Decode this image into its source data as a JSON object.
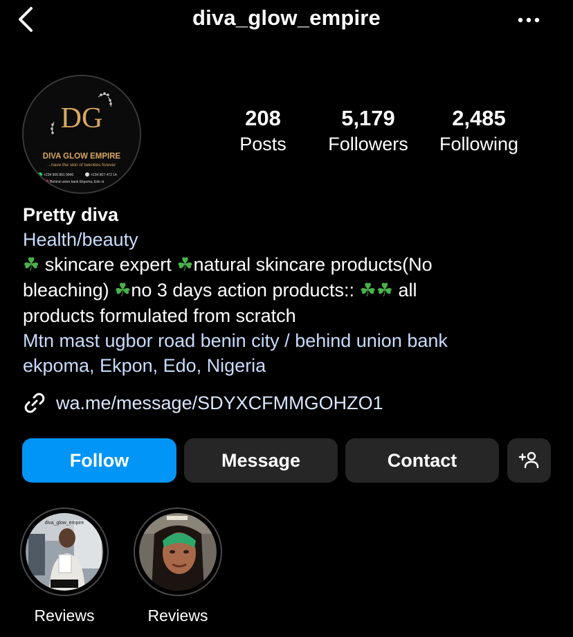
{
  "header": {
    "username": "diva_glow_empire",
    "back_icon": "chevron-left-icon",
    "more_icon": "more-horizontal-icon"
  },
  "avatar": {
    "monogram": "DG",
    "brand": "DIVA GLOW EMPIRE",
    "tagline": "...have the skin of twenties forever",
    "phone1": "+234 906 891 9940",
    "phone2": "+234 907 472 14",
    "address": "Behind union bank Ekpoma, Edo st"
  },
  "stats": [
    {
      "value": "208",
      "label": "Posts"
    },
    {
      "value": "5,179",
      "label": "Followers"
    },
    {
      "value": "2,485",
      "label": "Following"
    }
  ],
  "bio": {
    "name": "Pretty diva",
    "category": "Health/beauty",
    "line1": " skincare expert ",
    "line1b": "natural skincare products(No",
    "line2": "bleaching) ",
    "line2b": "no 3 days action products:: ",
    "line2c": " all",
    "line3": "products formulated from scratch",
    "location": "Mtn mast ugbor road benin city /  behind union bank\nekpoma, Ekpon, Edo, Nigeria",
    "emoji": "☘"
  },
  "link": {
    "text": "wa.me/message/SDYXCFMMGOHZO1",
    "icon": "link-icon"
  },
  "actions": {
    "follow": "Follow",
    "message": "Message",
    "contact": "Contact",
    "add_user_icon": "add-user-icon"
  },
  "highlights": [
    {
      "label": "Reviews",
      "overlay": "diva_glow_empire"
    },
    {
      "label": "Reviews",
      "overlay": ""
    }
  ],
  "colors": {
    "background": "#000000",
    "follow_button": "#0095f6",
    "secondary_button": "#262626",
    "link_text": "#c8dcfc",
    "brand_gold": "#d9a85f"
  }
}
